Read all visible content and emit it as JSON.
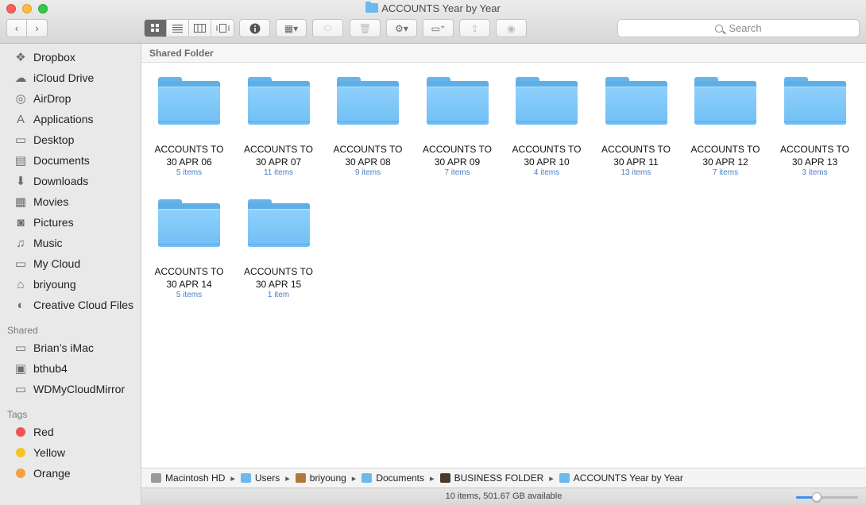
{
  "window": {
    "title": "ACCOUNTS Year by Year"
  },
  "toolbar": {
    "search_placeholder": "Search"
  },
  "sidebar": {
    "favorites": [
      {
        "label": "Dropbox",
        "icon": "dropbox-icon",
        "glyph": "❖"
      },
      {
        "label": "iCloud Drive",
        "icon": "cloud-icon",
        "glyph": "☁"
      },
      {
        "label": "AirDrop",
        "icon": "airdrop-icon",
        "glyph": "◎"
      },
      {
        "label": "Applications",
        "icon": "applications-icon",
        "glyph": "A"
      },
      {
        "label": "Desktop",
        "icon": "desktop-icon",
        "glyph": "▭"
      },
      {
        "label": "Documents",
        "icon": "documents-icon",
        "glyph": "▤"
      },
      {
        "label": "Downloads",
        "icon": "downloads-icon",
        "glyph": "⬇"
      },
      {
        "label": "Movies",
        "icon": "movies-icon",
        "glyph": "▦"
      },
      {
        "label": "Pictures",
        "icon": "pictures-icon",
        "glyph": "◙"
      },
      {
        "label": "Music",
        "icon": "music-icon",
        "glyph": "♫"
      },
      {
        "label": "My Cloud",
        "icon": "folder-icon",
        "glyph": "▭"
      },
      {
        "label": "briyoung",
        "icon": "home-icon",
        "glyph": "⌂"
      },
      {
        "label": "Creative Cloud Files",
        "icon": "creative-cloud-icon",
        "glyph": "◐"
      }
    ],
    "shared_heading": "Shared",
    "shared": [
      {
        "label": "Brian’s iMac",
        "icon": "imac-icon",
        "glyph": "▭"
      },
      {
        "label": "bthub4",
        "icon": "server-icon",
        "glyph": "▣"
      },
      {
        "label": "WDMyCloudMirror",
        "icon": "server-icon",
        "glyph": "▭"
      }
    ],
    "tags_heading": "Tags",
    "tags": [
      {
        "label": "Red",
        "color": "#f05454"
      },
      {
        "label": "Yellow",
        "color": "#f3c623"
      },
      {
        "label": "Orange",
        "color": "#f5a03e"
      }
    ]
  },
  "content": {
    "header": "Shared Folder",
    "folders": [
      {
        "line1": "ACCOUNTS TO",
        "line2": "30 APR 06",
        "count": "5 items"
      },
      {
        "line1": "ACCOUNTS TO",
        "line2": "30 APR 07",
        "count": "11 items"
      },
      {
        "line1": "ACCOUNTS TO",
        "line2": "30 APR 08",
        "count": "9 items"
      },
      {
        "line1": "ACCOUNTS TO",
        "line2": "30 APR 09",
        "count": "7 items"
      },
      {
        "line1": "ACCOUNTS TO",
        "line2": "30 APR 10",
        "count": "4 items"
      },
      {
        "line1": "ACCOUNTS TO",
        "line2": "30 APR 11",
        "count": "13 items"
      },
      {
        "line1": "ACCOUNTS TO",
        "line2": "30 APR 12",
        "count": "7 items"
      },
      {
        "line1": "ACCOUNTS TO",
        "line2": "30 APR 13",
        "count": "3 items"
      },
      {
        "line1": "ACCOUNTS TO",
        "line2": "30 APR 14",
        "count": "5 items"
      },
      {
        "line1": "ACCOUNTS TO",
        "line2": "30 APR 15",
        "count": "1 item"
      }
    ]
  },
  "pathbar": [
    {
      "label": "Macintosh HD",
      "icon": "hard-drive-icon",
      "color": "#9a9a9a"
    },
    {
      "label": "Users",
      "icon": "folder-icon",
      "color": "#6cb9ee"
    },
    {
      "label": "briyoung",
      "icon": "home-icon",
      "color": "#b07a3a"
    },
    {
      "label": "Documents",
      "icon": "folder-icon",
      "color": "#6cb9ee"
    },
    {
      "label": "BUSINESS FOLDER",
      "icon": "custom-folder-icon",
      "color": "#4a3a2a"
    },
    {
      "label": "ACCOUNTS Year by Year",
      "icon": "folder-icon",
      "color": "#6cb9ee"
    }
  ],
  "status": {
    "text": "10 items, 501.67 GB available",
    "zoom_level": 0.33
  }
}
